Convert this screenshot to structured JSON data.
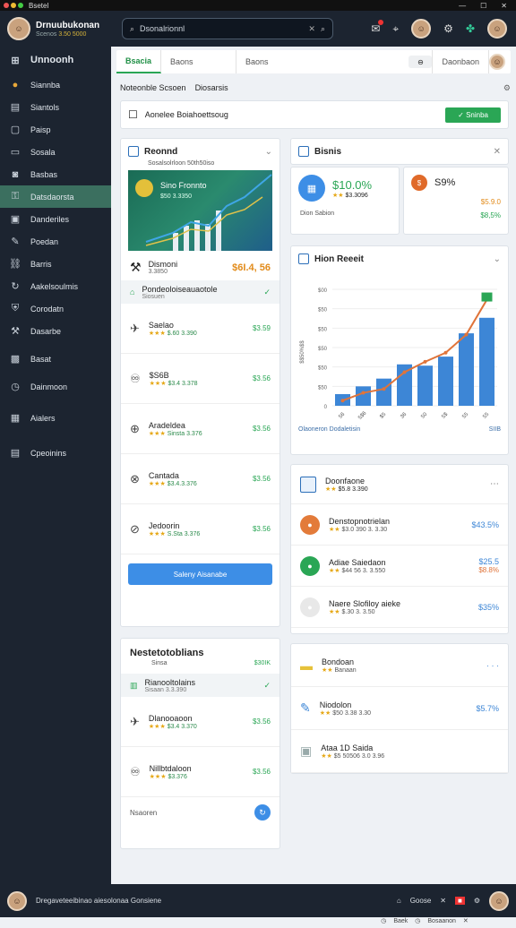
{
  "window": {
    "title": "Bsetel"
  },
  "user": {
    "name": "Drnuubukonan",
    "subtitle": "Scenos",
    "status": "3.50 5000"
  },
  "search": {
    "placeholder": "Dsonalrionnl"
  },
  "sidebar": {
    "items": [
      {
        "label": "Unnoonh",
        "icon": "grid-icon"
      },
      {
        "label": "Siannba",
        "icon": "circle-icon"
      },
      {
        "label": "Siantols",
        "icon": "bar-icon"
      },
      {
        "label": "Paisp",
        "icon": "box-icon"
      },
      {
        "label": "Sosala",
        "icon": "doc-icon"
      },
      {
        "label": "Basbas",
        "icon": "camera-icon"
      },
      {
        "label": "Datsdaorsta",
        "icon": "key-icon"
      },
      {
        "label": "Danderiles",
        "icon": "folder-icon"
      },
      {
        "label": "Poedan",
        "icon": "pen-icon"
      },
      {
        "label": "Barris",
        "icon": "link-icon"
      },
      {
        "label": "Aakelsoulmis",
        "icon": "refresh-icon"
      },
      {
        "label": "Corodatn",
        "icon": "shield-icon"
      },
      {
        "label": "Dasarbe",
        "icon": "wrench-icon"
      },
      {
        "label": "Basat",
        "icon": "image-icon"
      },
      {
        "label": "Dainmoon",
        "icon": "clock-icon"
      },
      {
        "label": "Aialers",
        "icon": "table-icon"
      },
      {
        "label": "Cpeoinins",
        "icon": "card-icon"
      }
    ]
  },
  "tabs": [
    {
      "label": "Bsacia"
    },
    {
      "label": "Baons"
    },
    {
      "label": "Baons"
    },
    {
      "label": "Daonbaon"
    }
  ],
  "page": {
    "title": "Noteonble Scsoen",
    "subtitle": "Diosarsis"
  },
  "action": {
    "label": "Aonelee Boiahoettsoug",
    "button": "Sninba"
  },
  "left_card": {
    "title": "Reonnd",
    "subtitle": "Sosalsolrloon 50th50iso",
    "promo_title": "Sino Fronnto",
    "promo_sub": "$50 3.3350",
    "highlight_title": "Dismoni",
    "highlight_sub": "3.3850",
    "highlight_val": "$6I.4, 56"
  },
  "section1": {
    "label": "Pondeoloiseauaotole",
    "sub": "Siosuen"
  },
  "list1": [
    {
      "title": "Saelao",
      "sub": "$.60 3.390",
      "val": "$3.59"
    },
    {
      "title": "$S6B",
      "sub": "$3.4 3.378",
      "val": "$3.56"
    },
    {
      "title": "Aradeldea",
      "sub": "Sinsta 3.376",
      "val": "$3.56"
    },
    {
      "title": "Cantada",
      "sub": "$3.4.3.376",
      "val": "$3.56"
    },
    {
      "title": "Jedoorin",
      "sub": "S.Sta 3.376",
      "val": "$3.56"
    }
  ],
  "blue_button": "Saleny Aisanabe",
  "left_card2": {
    "title": "Nestetotoblians",
    "sub": "Sinsa",
    "val": "$30IK"
  },
  "section2": {
    "label": "Rianooltolains",
    "sub": "Sisaan 3.3.390"
  },
  "list2": [
    {
      "title": "Dlanooaoon",
      "sub": "$3.4 3.370",
      "val": "$3.56"
    },
    {
      "title": "Nillbtdaloon",
      "sub": "$3.376",
      "val": "$3.56"
    }
  ],
  "left_card2_footer": "Nsaoren",
  "binits": {
    "title": "Bisnis"
  },
  "stat1": {
    "value": "$10.0%",
    "sub": "$3.3096",
    "label": "Dion Sabion"
  },
  "stat2": {
    "value": "S9%",
    "sub": "$5.9.0",
    "val": "$8,5%"
  },
  "chart_card": {
    "title": "Hion Reeeit",
    "footer": "Olaoneron Dodaletisin",
    "footer_val": "SIIB"
  },
  "chart_data": {
    "type": "bar",
    "categories": [
      "56",
      "5$6",
      "$5",
      "36",
      "50",
      "5$",
      "55",
      "55"
    ],
    "values": [
      0.9,
      1.5,
      2.1,
      3.2,
      3.1,
      3.8,
      5.6,
      6.8
    ],
    "series": [
      {
        "values": [
          0.4,
          1.0,
          1.3,
          2.6,
          3.4,
          4.1,
          5.5,
          8.2
        ]
      }
    ],
    "yticks": [
      "0",
      "$50",
      "$50",
      "$50",
      "$50",
      "$50",
      "$00"
    ],
    "ylabel": "$$50%$$",
    "colors": {
      "bar": "#3d86d6",
      "line": "#e0743a",
      "accent": "#2aa655"
    }
  },
  "right_list1": {
    "title": "Doonfaone",
    "title_sub": "$5.8 3.390",
    "items": [
      {
        "title": "Denstopnotrielan",
        "sub": "$3.0 390 3. 3.30",
        "val": "$43.5%",
        "color": "#e37b3a"
      },
      {
        "title": "Adiae Saiedaon",
        "sub": "$44 56 3. 3.550",
        "val": "$25.5",
        "val2": "$8.8%",
        "color": "#2aa655"
      },
      {
        "title": "Naere Slofiloy aieke",
        "sub": "$.30 3. 3.50",
        "val": "$35%",
        "color": "#e8e8e8"
      }
    ]
  },
  "right_list2": {
    "items": [
      {
        "title": "Bondoan",
        "sub": "Banaan",
        "val": "· · ·"
      },
      {
        "title": "Niodolon",
        "sub": "$50 3.38 3.30",
        "val": "$5.7%"
      },
      {
        "title": "Ataa 1D Saida",
        "sub": "$5 50506 3.0 3.96",
        "val": ""
      }
    ]
  },
  "pager": {
    "text": "Baek",
    "text2": "Bosaanon"
  },
  "footer": {
    "text": "Dregaveteeibinao aiesolonaa Gonsiene",
    "right": "Goose"
  }
}
